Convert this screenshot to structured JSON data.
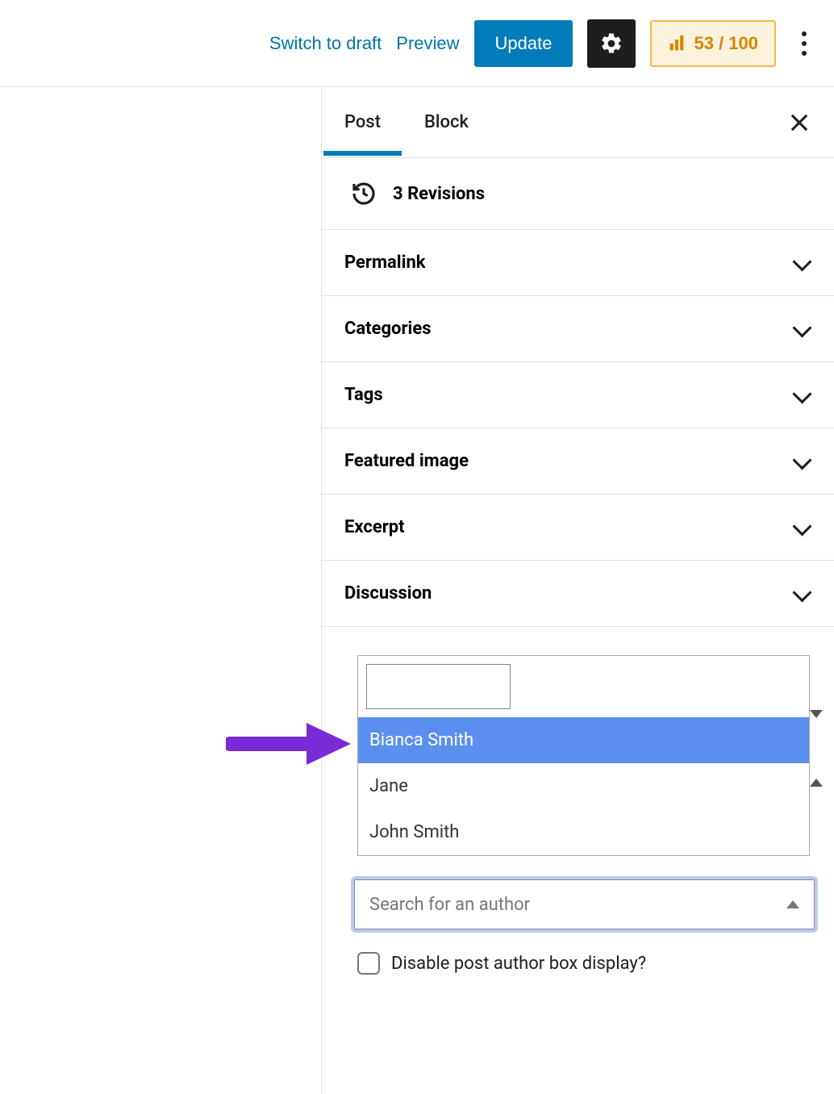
{
  "toolbar": {
    "switch_draft": "Switch to draft",
    "preview": "Preview",
    "update": "Update",
    "seo_score": "53 / 100"
  },
  "tabs": {
    "post": "Post",
    "block": "Block",
    "active": "post"
  },
  "revisions": {
    "label": "3 Revisions"
  },
  "panels": [
    {
      "key": "permalink",
      "label": "Permalink"
    },
    {
      "key": "categories",
      "label": "Categories"
    },
    {
      "key": "tags",
      "label": "Tags"
    },
    {
      "key": "featured_image",
      "label": "Featured image"
    },
    {
      "key": "excerpt",
      "label": "Excerpt"
    },
    {
      "key": "discussion",
      "label": "Discussion"
    }
  ],
  "author_select": {
    "options": [
      "Bianca Smith",
      "Jane",
      "John Smith"
    ],
    "highlighted": 0,
    "placeholder": "Search for an author"
  },
  "disable_author_box": {
    "label": "Disable post author box display?",
    "checked": false
  }
}
